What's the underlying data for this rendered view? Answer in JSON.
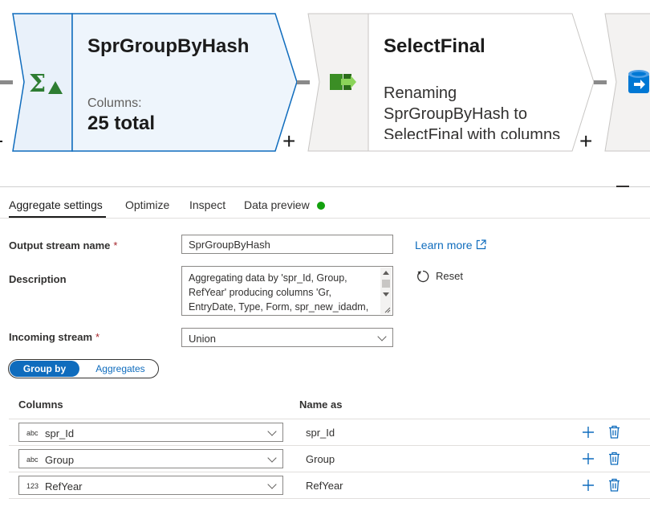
{
  "flow": {
    "node_groupby": {
      "title": "SprGroupByHash",
      "columns_label": "Columns:",
      "columns_value": "25 total",
      "icon": "sigma-aggregate-icon"
    },
    "node_select": {
      "title": "SelectFinal",
      "description": "Renaming SprGroupByHash to SelectFinal with columns 'Id, %, GroupCode'",
      "icon": "select-arrow-icon"
    },
    "node_sink": {
      "icon": "database-sink-icon"
    },
    "add_symbol": "+"
  },
  "tabs": [
    {
      "label": "Aggregate settings",
      "active": true
    },
    {
      "label": "Optimize",
      "active": false
    },
    {
      "label": "Inspect",
      "active": false
    },
    {
      "label": "Data preview",
      "active": false,
      "status_color": "#13a10e"
    }
  ],
  "form": {
    "output_stream_label": "Output stream name",
    "required_marker": "*",
    "output_stream_value": "SprGroupByHash",
    "learn_more": "Learn more",
    "description_label": "Description",
    "description_value": "Aggregating data by 'spr_Id, Group, RefYear' producing columns 'Gr, EntryDate, Type, Form, spr_new_idadm,",
    "reset": "Reset",
    "incoming_stream_label": "Incoming stream",
    "incoming_stream_value": "Union"
  },
  "toggle": {
    "group_by": "Group by",
    "aggregates": "Aggregates",
    "selected": "Group by"
  },
  "grid": {
    "columns_header": "Columns",
    "name_as_header": "Name as",
    "rows": [
      {
        "type": "abc",
        "column": "spr_Id",
        "name_as": "spr_Id"
      },
      {
        "type": "abc",
        "column": "Group",
        "name_as": "Group"
      },
      {
        "type": "123",
        "column": "RefYear",
        "name_as": "RefYear"
      }
    ]
  },
  "colors": {
    "accent": "#0f6cbd",
    "status_green": "#13a10e",
    "node_selected_fill": "#edf4fb",
    "node_selected_border": "#0f6cbd"
  }
}
